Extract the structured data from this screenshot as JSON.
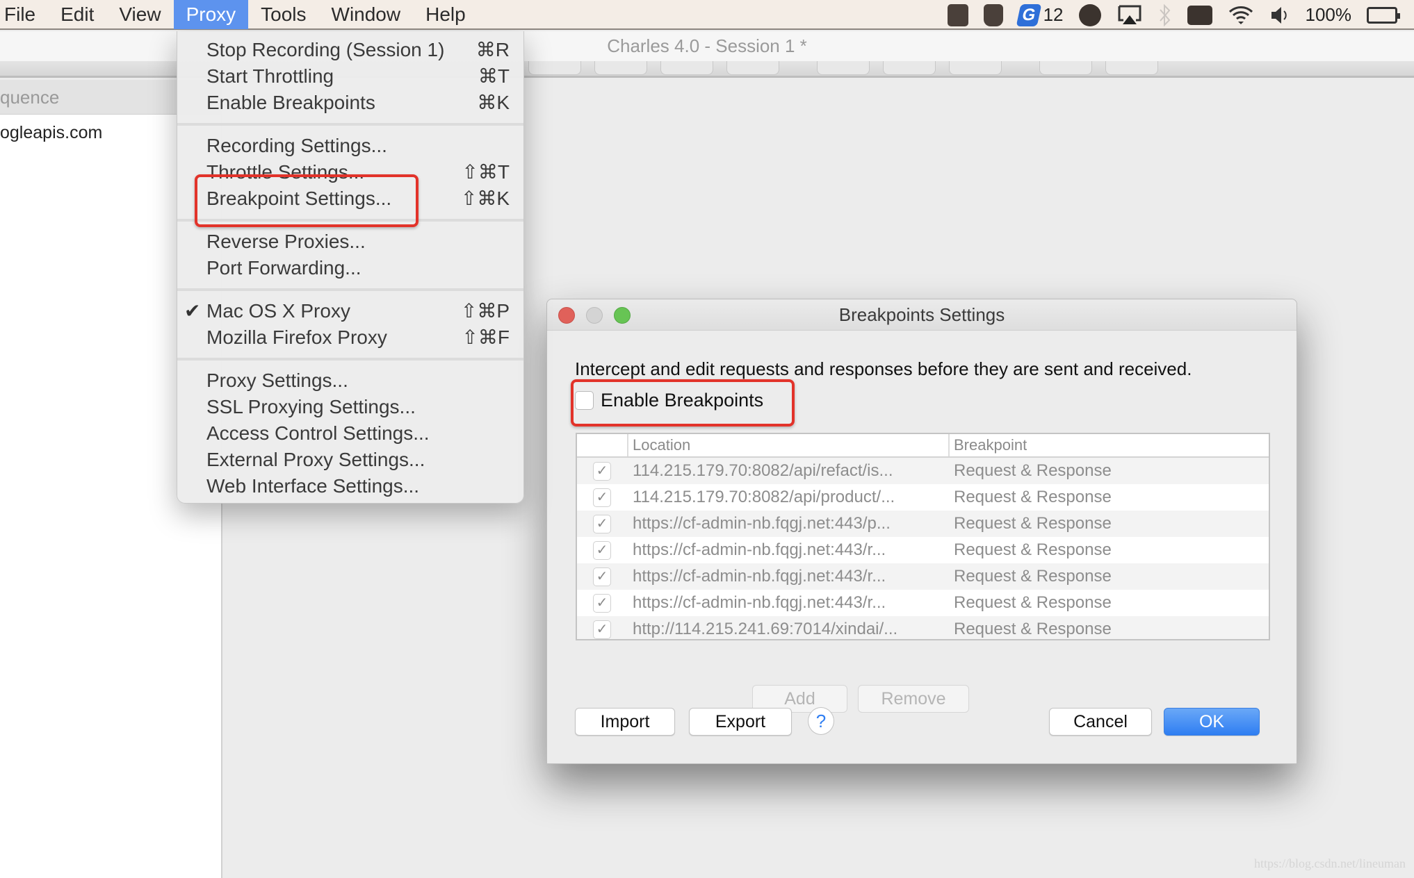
{
  "menubar": {
    "items": [
      "File",
      "Edit",
      "View",
      "Proxy",
      "Tools",
      "Window",
      "Help"
    ],
    "active_item": "Proxy",
    "status": {
      "badge_count": "12",
      "battery": "100%",
      "icons": [
        "note-app-icon",
        "jug-app-icon",
        "g-app-icon",
        "dingtalk-icon",
        "airplay-icon",
        "bluetooth-icon",
        "keyboard-icon",
        "wifi-icon",
        "volume-icon",
        "battery-icon"
      ]
    }
  },
  "window": {
    "title": "Charles 4.0 - Session 1 *",
    "sidebar_header": "quence",
    "sidebar_rows": [
      "ogleapis.com"
    ]
  },
  "proxy_menu": {
    "groups": [
      [
        {
          "label": "Stop Recording (Session 1)",
          "shortcut": "⌘R"
        },
        {
          "label": "Start Throttling",
          "shortcut": "⌘T"
        },
        {
          "label": "Enable Breakpoints",
          "shortcut": "⌘K"
        }
      ],
      [
        {
          "label": "Recording Settings...",
          "shortcut": ""
        },
        {
          "label": "Throttle Settings...",
          "shortcut": "⇧⌘T"
        },
        {
          "label": "Breakpoint Settings...",
          "shortcut": "⇧⌘K"
        }
      ],
      [
        {
          "label": "Reverse Proxies...",
          "shortcut": ""
        },
        {
          "label": "Port Forwarding...",
          "shortcut": ""
        }
      ],
      [
        {
          "label": "Mac OS X Proxy",
          "shortcut": "⇧⌘P",
          "checked": true
        },
        {
          "label": "Mozilla Firefox Proxy",
          "shortcut": "⇧⌘F"
        }
      ],
      [
        {
          "label": "Proxy Settings...",
          "shortcut": ""
        },
        {
          "label": "SSL Proxying Settings...",
          "shortcut": ""
        },
        {
          "label": "Access Control Settings...",
          "shortcut": ""
        },
        {
          "label": "External Proxy Settings...",
          "shortcut": ""
        },
        {
          "label": "Web Interface Settings...",
          "shortcut": ""
        }
      ]
    ],
    "check_glyph": "✔"
  },
  "dialog": {
    "title": "Breakpoints Settings",
    "description": "Intercept and edit requests and responses before they are sent and received.",
    "enable_label": "Enable Breakpoints",
    "enable_checked": false,
    "table": {
      "columns": [
        "",
        "Location",
        "Breakpoint"
      ],
      "rows": [
        {
          "enabled": true,
          "location": "114.215.179.70:8082/api/refact/is...",
          "breakpoint": "Request & Response"
        },
        {
          "enabled": true,
          "location": "114.215.179.70:8082/api/product/...",
          "breakpoint": "Request & Response"
        },
        {
          "enabled": true,
          "location": "https://cf-admin-nb.fqgj.net:443/p...",
          "breakpoint": "Request & Response"
        },
        {
          "enabled": true,
          "location": "https://cf-admin-nb.fqgj.net:443/r...",
          "breakpoint": "Request & Response"
        },
        {
          "enabled": true,
          "location": "https://cf-admin-nb.fqgj.net:443/r...",
          "breakpoint": "Request & Response"
        },
        {
          "enabled": true,
          "location": "https://cf-admin-nb.fqgj.net:443/r...",
          "breakpoint": "Request & Response"
        },
        {
          "enabled": true,
          "location": "http://114.215.241.69:7014/xindai/...",
          "breakpoint": "Request & Response"
        }
      ]
    },
    "buttons": {
      "add": "Add",
      "remove": "Remove",
      "import": "Import",
      "export": "Export",
      "help": "?",
      "cancel": "Cancel",
      "ok": "OK"
    }
  },
  "watermark": "https://blog.csdn.net/lineuman",
  "colors": {
    "menu_highlight": "#5d93ee",
    "annotation_red": "#e2332a",
    "ok_blue": "#2f7ef2"
  }
}
